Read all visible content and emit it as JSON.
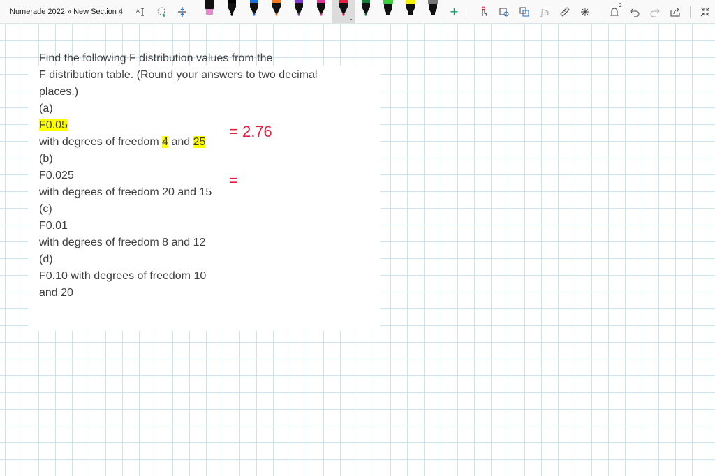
{
  "breadcrumb": "Numerade 2022 » New Section 4",
  "toolbar": {
    "left_icons": [
      "text-cursor-icon",
      "lasso-add-icon",
      "insert-space-icon"
    ],
    "pens": [
      {
        "name": "highlighter-pink",
        "color": "#e48ad1"
      },
      {
        "name": "pen-black",
        "color": "#000000"
      },
      {
        "name": "pen-blue",
        "color": "#1e6fd9"
      },
      {
        "name": "pen-orange",
        "color": "#f07a22"
      },
      {
        "name": "pen-purple",
        "color": "#7a3ec9"
      },
      {
        "name": "pen-magenta",
        "color": "#d43b8e"
      },
      {
        "name": "pen-red-selected",
        "color": "#e4203f"
      },
      {
        "name": "pen-dark-green",
        "color": "#1a7a3a"
      },
      {
        "name": "highlighter-green",
        "color": "#3bd13b"
      },
      {
        "name": "highlighter-yellow",
        "color": "#f4f100"
      },
      {
        "name": "highlighter-gray",
        "color": "#777777"
      }
    ],
    "add_pen": "+",
    "right_icons": [
      "touch-draw-icon",
      "shape-to-ink-icon",
      "ink-to-shape-icon",
      "math-icon",
      "ruler-icon",
      "replay-icon",
      "notification-icon",
      "undo-icon",
      "redo-icon",
      "share-icon",
      "collapse-icon"
    ],
    "notification_count": "2"
  },
  "question": {
    "lines": [
      "Find the following F distribution values from the",
      "F distribution table. (Round your answers to two decimal",
      "places.)",
      "(a)",
      "F0.05",
      "with degrees of freedom 4 and 25",
      "(b)",
      "F0.025",
      "with degrees of freedom 20 and 15",
      "(c)",
      "F0.01",
      "with degrees of freedom 8 and 12",
      "(d)",
      "F0.10 with degrees of freedom 10",
      "and 20"
    ],
    "a_dof_prefix": "with degrees of freedom ",
    "a_dof_1": "4",
    "a_dof_mid": " and ",
    "a_dof_2": "25"
  },
  "ink": {
    "answer_a": "= 2.76",
    "answer_b": "="
  },
  "colors": {
    "ink": "#e4203f",
    "highlight": "#ffff00",
    "grid": "#c9e4ec"
  }
}
